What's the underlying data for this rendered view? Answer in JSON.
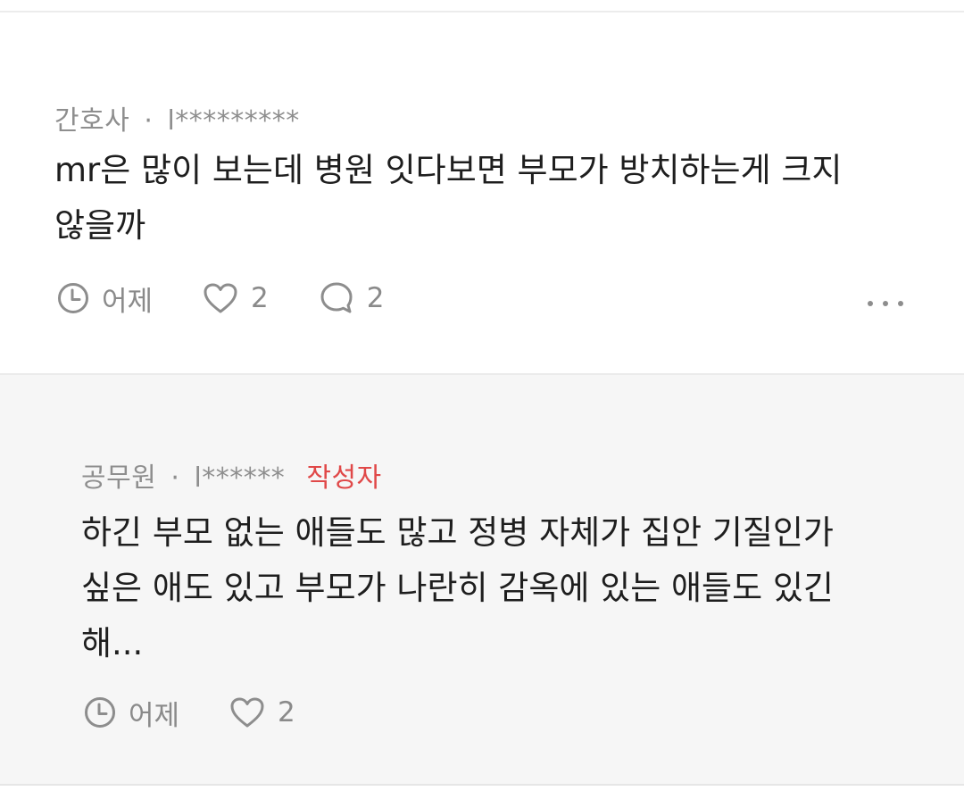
{
  "comment": {
    "job": "간호사",
    "separator": "·",
    "user": "l*********",
    "text": "mr은 많이 보는데 병원 잇다보면 부모가 방치하는게 크지\n않을까",
    "time": "어제",
    "likes": "2",
    "replies": "2",
    "icons": [
      "clock-icon",
      "heart-icon",
      "speech-bubble-icon",
      "more-dots-icon"
    ]
  },
  "reply": {
    "job": "공무원",
    "separator": "·",
    "user": "l******",
    "author_tag": "작성자",
    "text": "하긴 부모 없는 애들도 많고 정병 자체가 집안 기질인가\n싶은 애도 있고 부모가 나란히 감옥에 있는 애들도 있긴\n해...",
    "time": "어제",
    "likes": "2",
    "icons": [
      "clock-icon",
      "heart-icon"
    ]
  },
  "colors": {
    "author_tag": "#e04848",
    "meta_text": "#8e8e8e",
    "body_text": "#1e1e1e",
    "reply_background": "#f6f6f6"
  }
}
